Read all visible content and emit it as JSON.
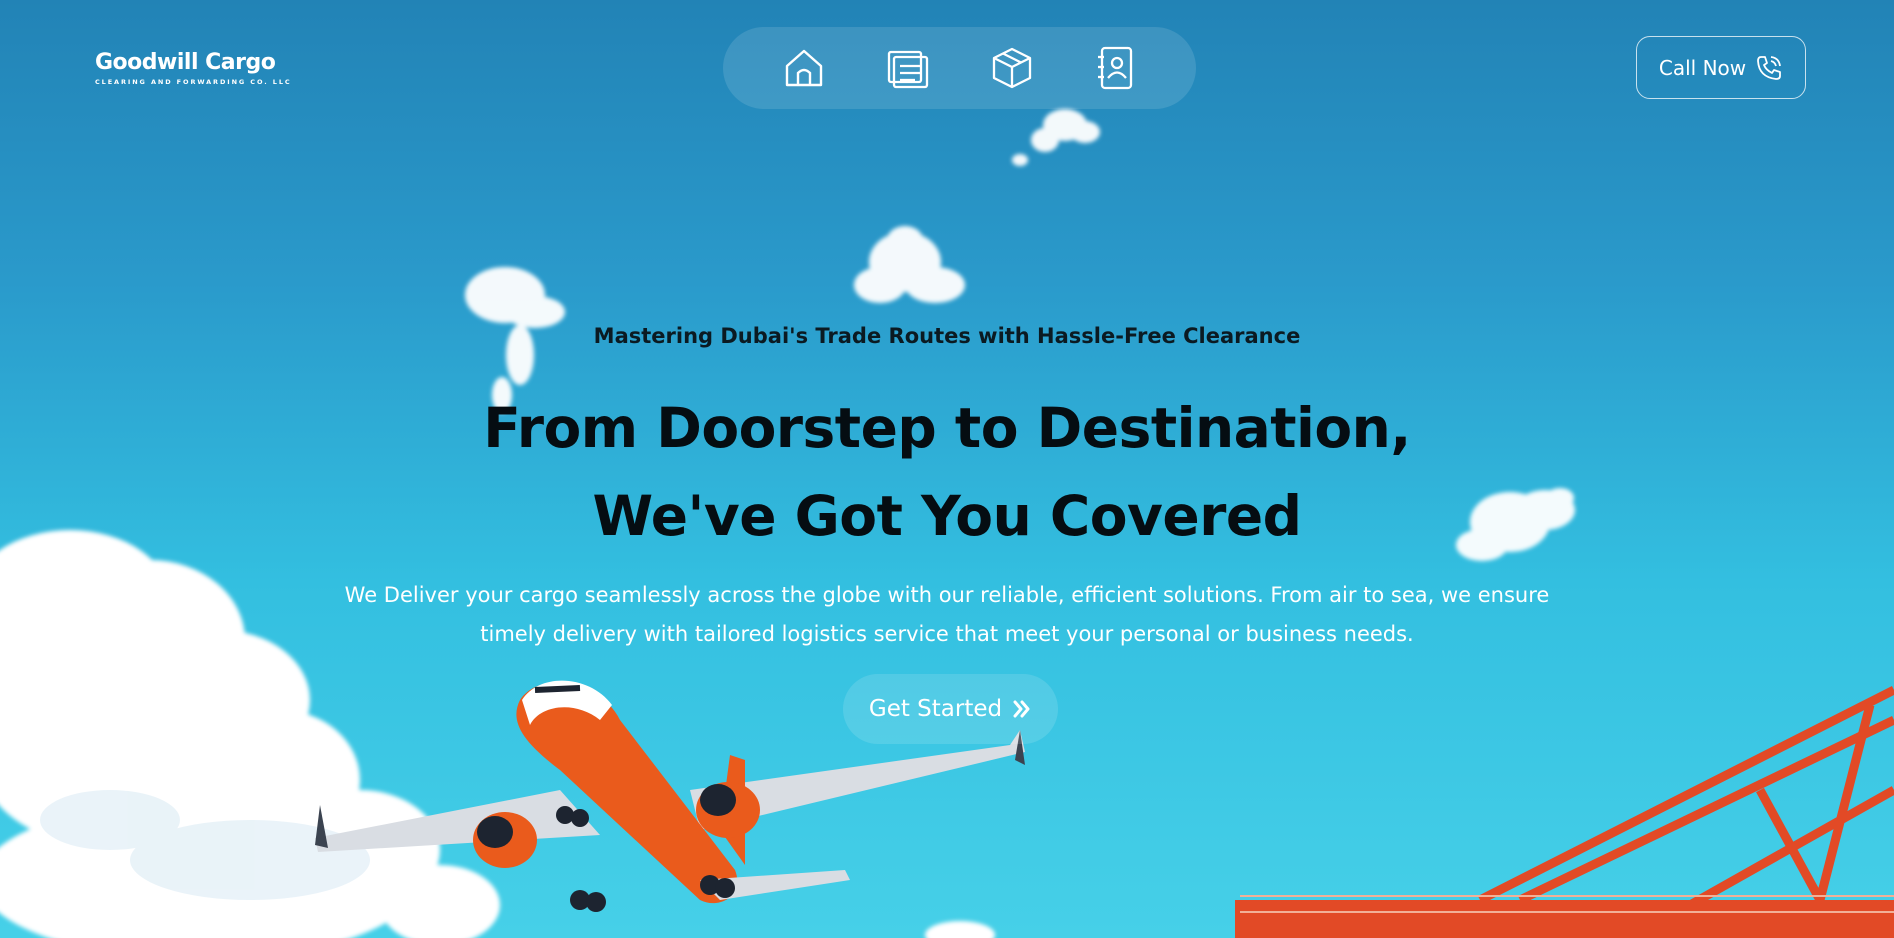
{
  "brand": {
    "name": "Goodwill Cargo",
    "tagline": "CLEARING AND FORWARDING CO. LLC"
  },
  "nav": {
    "items": [
      {
        "icon": "home-icon"
      },
      {
        "icon": "services-document-icon"
      },
      {
        "icon": "package-box-icon"
      },
      {
        "icon": "contact-book-icon"
      }
    ]
  },
  "call_button": {
    "label": "Call Now",
    "icon": "phone-call-icon"
  },
  "hero": {
    "subtitle": "Mastering Dubai's Trade Routes with Hassle-Free Clearance",
    "headline_line1": "From Doorstep to Destination,",
    "headline_line2": "We've Got You Covered",
    "desc_line1": "We Deliver your cargo seamlessly across the globe with our reliable, efficient solutions. From air to sea, we ensure",
    "desc_line2": "timely delivery with tailored logistics service that meet your personal or business needs."
  },
  "cta": {
    "label": "Get Started",
    "icon": "double-chevron-right-icon"
  },
  "colors": {
    "sky_top": "#2283b6",
    "sky_bottom": "#46d0e8",
    "plane_orange": "#ea5b1c",
    "crane_red": "#e24a26",
    "text_dark": "#050d12"
  }
}
